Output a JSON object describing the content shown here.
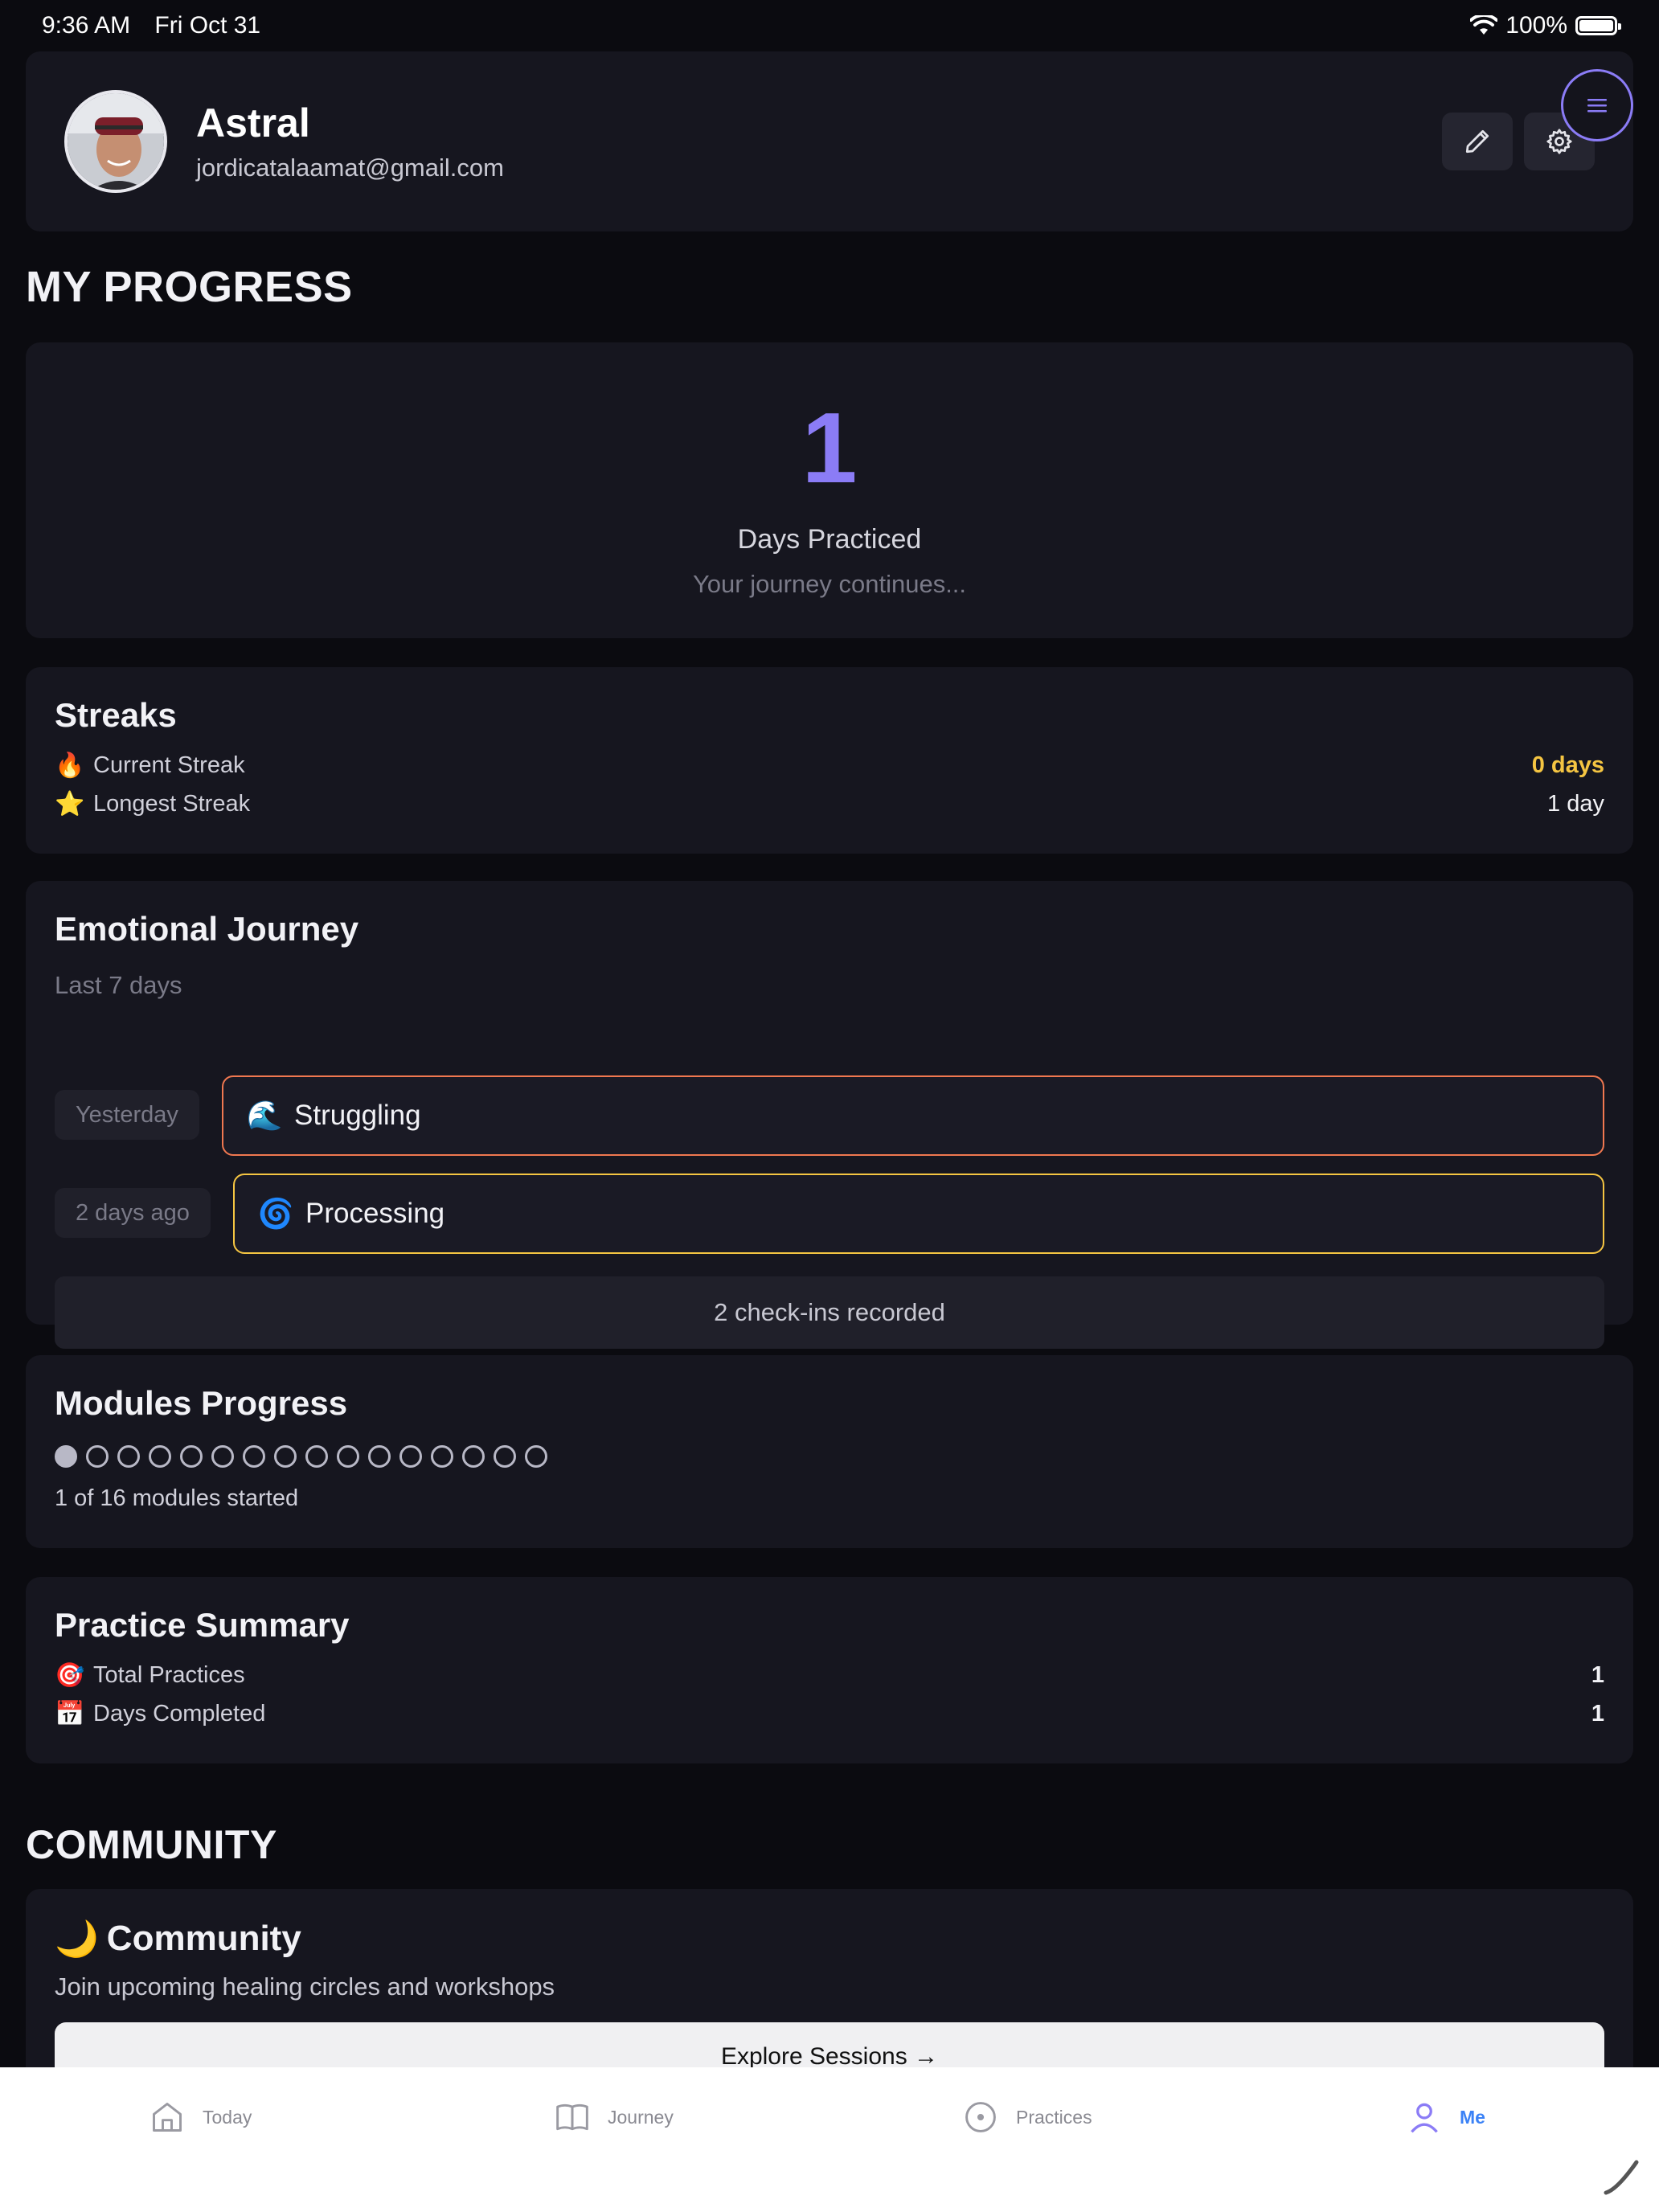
{
  "status_bar": {
    "time": "9:36 AM",
    "date": "Fri Oct 31",
    "battery": "100%",
    "battery_level": 1.0
  },
  "profile": {
    "name": "Astral",
    "email": "jordicatalaamat@gmail.com",
    "icons": {
      "edit": "pencil-icon",
      "settings": "gear-icon",
      "menu": "hamburger-menu-icon"
    }
  },
  "sections": {
    "progress": "MY PROGRESS",
    "community": "COMMUNITY"
  },
  "days": {
    "number": "1",
    "label": "Days Practiced",
    "subtitle": "Your journey continues..."
  },
  "streaks": {
    "title": "Streaks",
    "current": {
      "emoji": "🔥",
      "label": "Current Streak",
      "value": "0 days"
    },
    "longest": {
      "emoji": "⭐",
      "label": "Longest Streak",
      "value": "1 day"
    },
    "colors": {
      "current_value": "#f5c542"
    }
  },
  "emotional": {
    "title": "Emotional Journey",
    "subtitle": "Last 7 days",
    "entries": [
      {
        "when": "Yesterday",
        "emoji": "🌊",
        "mood": "Struggling",
        "border": "#f07850"
      },
      {
        "when": "2 days ago",
        "emoji": "🌀",
        "mood": "Processing",
        "border": "#f5c542"
      }
    ],
    "summary": "2 check-ins recorded"
  },
  "modules": {
    "title": "Modules Progress",
    "total": 16,
    "started": 1,
    "summary": "1 of 16 modules started"
  },
  "practice": {
    "title": "Practice Summary",
    "total": {
      "emoji": "🎯",
      "label": "Total Practices",
      "value": "1"
    },
    "days": {
      "emoji": "📅",
      "label": "Days Completed",
      "value": "1"
    }
  },
  "community": {
    "emoji": "🌙",
    "title": "Community",
    "subtitle": "Join upcoming healing circles and workshops",
    "button": "Explore Sessions →"
  },
  "tabs": [
    {
      "label": "Today",
      "icon": "home-icon"
    },
    {
      "label": "Journey",
      "icon": "book-icon"
    },
    {
      "label": "Practices",
      "icon": "compass-icon"
    },
    {
      "label": "Me",
      "icon": "person-icon",
      "active": true
    }
  ],
  "colors": {
    "accent": "#8b7cf6",
    "background": "#0b0b10",
    "card": "#16161f",
    "tab_active": "#3b82f6"
  }
}
